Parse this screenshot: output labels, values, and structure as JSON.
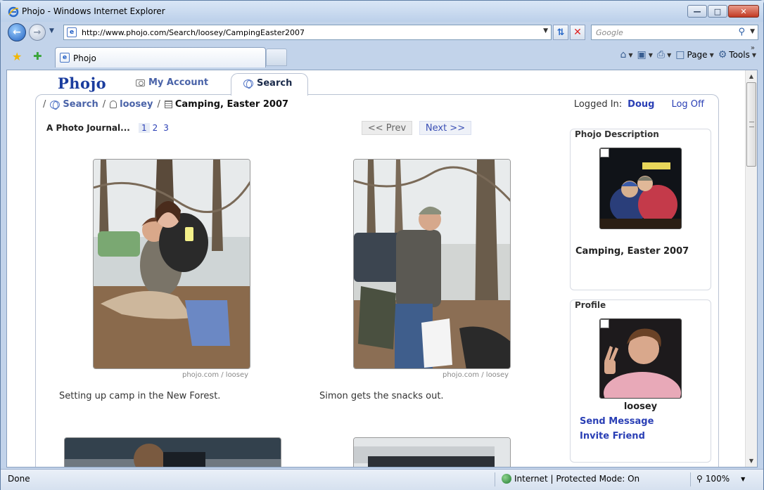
{
  "window": {
    "title": "Phojo - Windows Internet Explorer"
  },
  "address_bar": {
    "url": "http://www.phojo.com/Search/loosey/CampingEaster2007"
  },
  "search": {
    "placeholder": "Google"
  },
  "tab": {
    "label": "Phojo"
  },
  "commands": {
    "page": "Page",
    "tools": "Tools"
  },
  "site": {
    "logo": "Phojo",
    "tabs": {
      "my_account": "My Account",
      "search": "Search"
    }
  },
  "breadcrumb": {
    "sep": "/",
    "search": "Search",
    "user": "loosey",
    "album": "Camping, Easter 2007"
  },
  "login": {
    "label": "Logged In:",
    "user": "Doug",
    "logoff": "Log Off"
  },
  "journal": {
    "title": "A Photo Journal...",
    "pages": [
      "1",
      "2",
      "3"
    ],
    "prev": "<< Prev",
    "next": "Next >>"
  },
  "photos": [
    {
      "credit": "phojo.com / loosey",
      "caption": "Setting up camp in the New Forest."
    },
    {
      "credit": "phojo.com / loosey",
      "caption": "Simon gets the snacks out."
    }
  ],
  "sidebar": {
    "description": {
      "title": "Phojo Description",
      "caption": "Camping, Easter 2007"
    },
    "profile": {
      "title": "Profile",
      "name": "loosey",
      "send_message": "Send Message",
      "invite_friend": "Invite Friend"
    }
  },
  "status": {
    "text": "Done",
    "zone": "Internet | Protected Mode: On",
    "zoom": "100%"
  },
  "colors": {
    "link": "#2a3fb5",
    "logo": "#1b3d9e",
    "tab_text": "#4a63a8"
  }
}
